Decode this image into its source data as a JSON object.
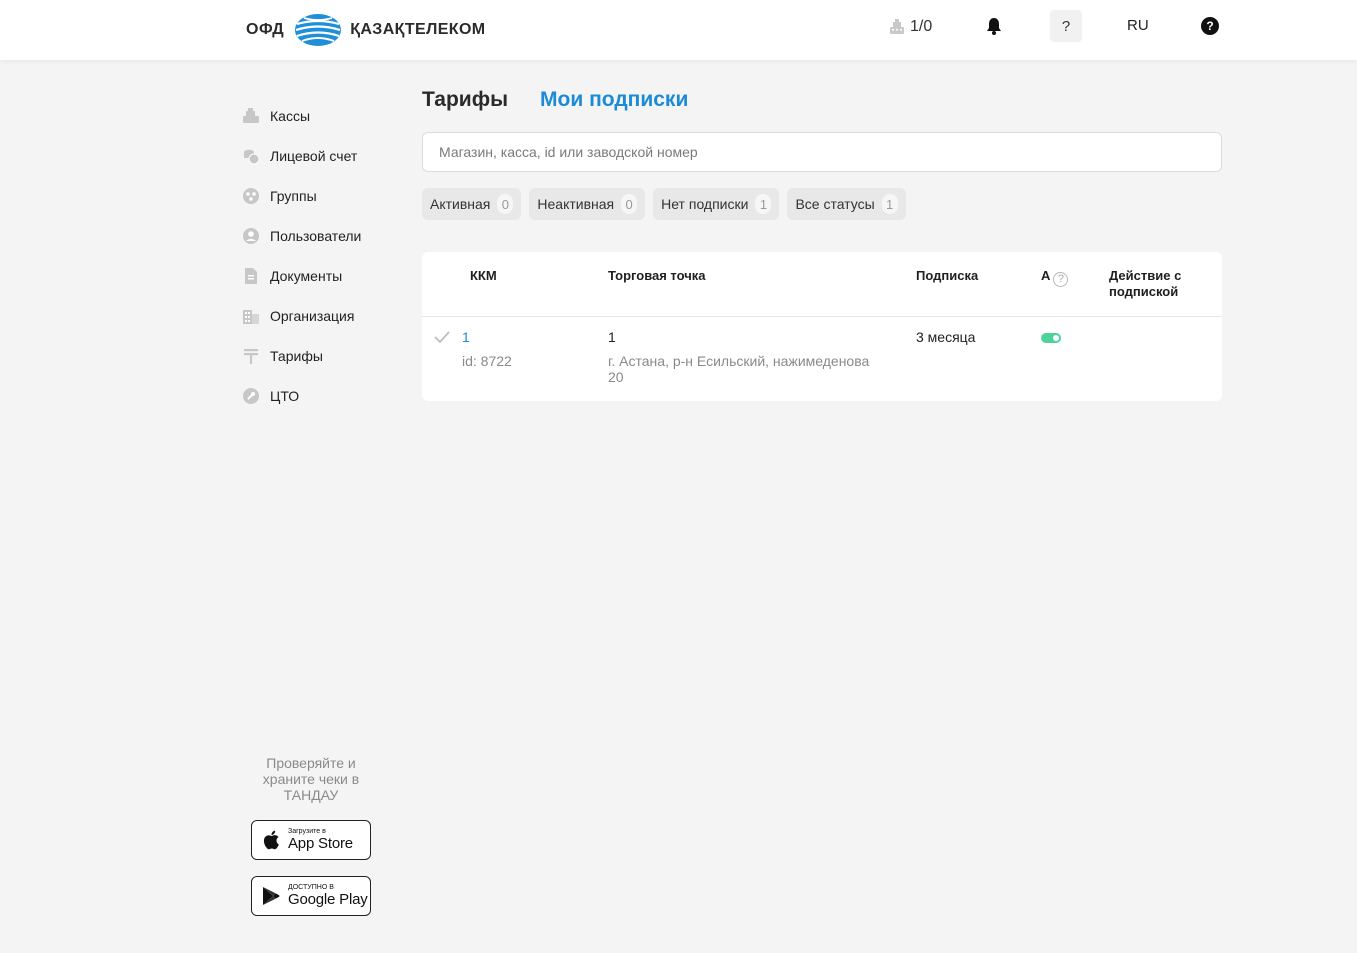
{
  "header": {
    "brand_prefix": "ОФД",
    "brand_name": "ҚАЗАҚТЕЛЕКОМ",
    "kkm_counter": "1/0",
    "help_short": "?",
    "language": "RU",
    "help_icon_glyph": "?"
  },
  "sidebar": {
    "items": [
      {
        "label": "Кассы",
        "icon": "cash-register-icon"
      },
      {
        "label": "Лицевой счет",
        "icon": "coins-icon"
      },
      {
        "label": "Группы",
        "icon": "groups-icon"
      },
      {
        "label": "Пользователи",
        "icon": "user-icon"
      },
      {
        "label": "Документы",
        "icon": "document-icon"
      },
      {
        "label": "Организация",
        "icon": "building-icon"
      },
      {
        "label": "Тарифы",
        "icon": "tenge-icon"
      },
      {
        "label": "ЦТО",
        "icon": "wrench-icon"
      }
    ],
    "promo_text": "Проверяйте и храните чеки в ТАНДАУ",
    "appstore_small": "Загрузите в",
    "appstore_big": "App Store",
    "googleplay_small": "ДОСТУПНО В",
    "googleplay_big": "Google Play"
  },
  "main": {
    "tab_tarify": "Тарифы",
    "tab_subscriptions": "Мои подписки",
    "search_placeholder": "Магазин, касса, id или заводской номер",
    "filters": [
      {
        "label": "Активная",
        "count": "0"
      },
      {
        "label": "Неактивная",
        "count": "0"
      },
      {
        "label": "Нет подписки",
        "count": "1"
      },
      {
        "label": "Все статусы",
        "count": "1"
      }
    ],
    "table": {
      "columns": {
        "kkm": "ККМ",
        "point": "Торговая точка",
        "subscription": "Подписка",
        "auto": "А",
        "auto_help": "?",
        "action": "Действие с подпиской"
      },
      "rows": [
        {
          "kkm_name": "1",
          "kkm_id": "id: 8722",
          "point_name": "1",
          "point_address": "г. Астана, р-н Есильский, нажимеденова 20",
          "subscription": "3 месяца",
          "auto_renew": true
        }
      ]
    }
  },
  "colors": {
    "accent": "#1b8bd6",
    "toggle_on": "#4cd39a",
    "background": "#f4f4f4"
  }
}
